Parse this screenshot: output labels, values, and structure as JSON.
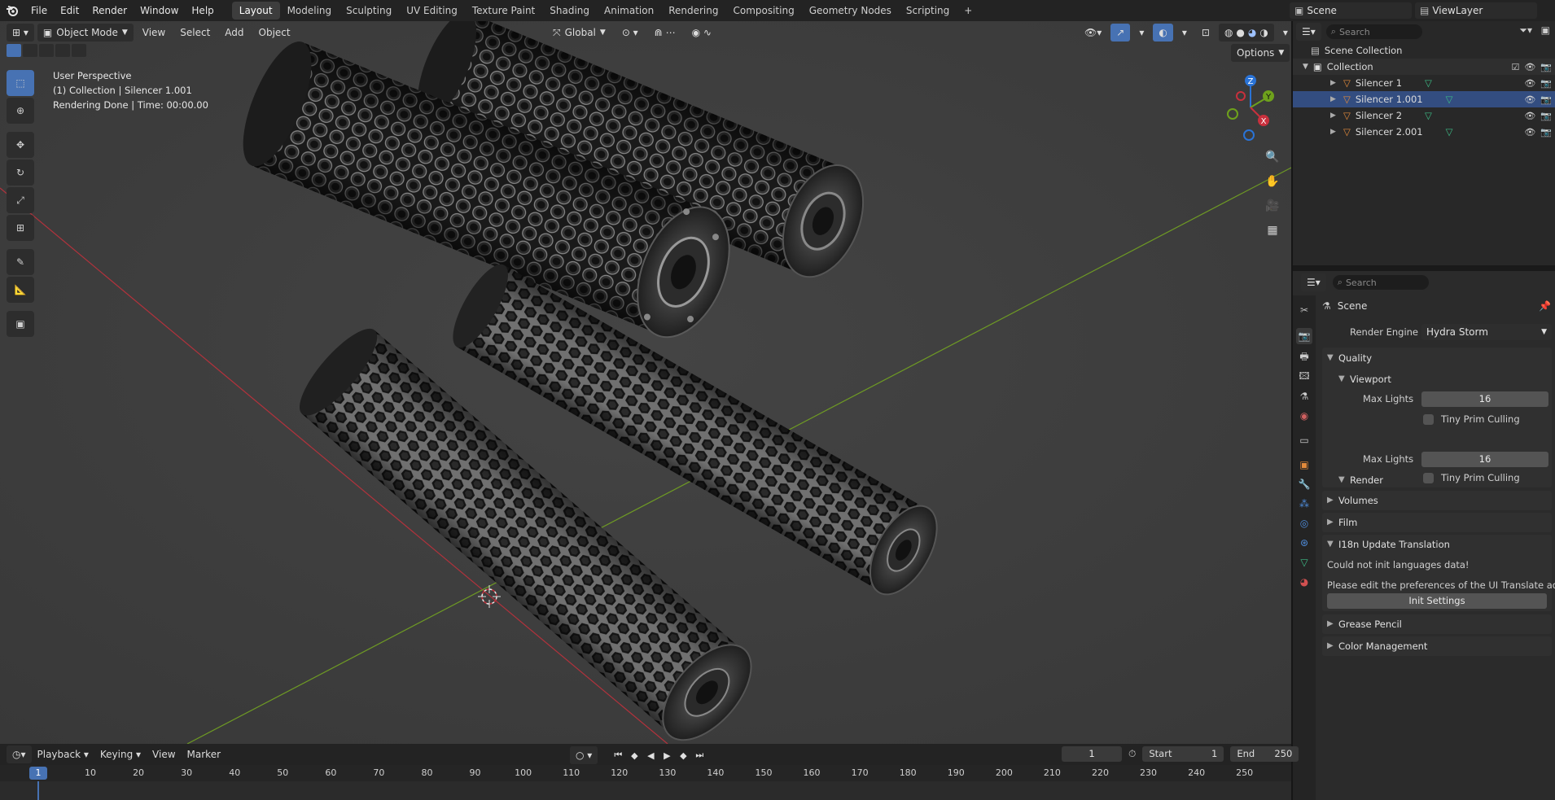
{
  "app": {
    "menus": [
      "File",
      "Edit",
      "Render",
      "Window",
      "Help"
    ],
    "workspaces": [
      "Layout",
      "Modeling",
      "Sculpting",
      "UV Editing",
      "Texture Paint",
      "Shading",
      "Animation",
      "Rendering",
      "Compositing",
      "Geometry Nodes",
      "Scripting"
    ],
    "active_workspace": "Layout",
    "add_workspace": "+",
    "scene": "Scene",
    "view_layer": "ViewLayer"
  },
  "viewport": {
    "mode": "Object Mode",
    "menus": [
      "View",
      "Select",
      "Add",
      "Object"
    ],
    "transform_orientation": "Global",
    "options_label": "Options",
    "overlay_lines": [
      "User Perspective",
      "(1) Collection | Silencer 1.001",
      "Rendering Done | Time: 00:00.00"
    ],
    "gizmo_labels": {
      "x": "X",
      "y": "Y",
      "z": "Z"
    },
    "colors": {
      "x_axis": "#c8303d",
      "y_axis": "#6ea11c",
      "z_axis": "#2a73d6",
      "active_tool": "#4772b3"
    }
  },
  "outliner": {
    "search_placeholder": "Search",
    "root": "Scene Collection",
    "collection": "Collection",
    "objects": [
      {
        "name": "Silencer 1",
        "selected": false
      },
      {
        "name": "Silencer 1.001",
        "selected": true
      },
      {
        "name": "Silencer 2",
        "selected": false
      },
      {
        "name": "Silencer 2.001",
        "selected": false
      }
    ]
  },
  "properties": {
    "search_placeholder": "Search",
    "context": "Scene",
    "render_engine_label": "Render Engine",
    "render_engine": "Hydra Storm",
    "quality_label": "Quality",
    "viewport_label": "Viewport",
    "render_label": "Render",
    "max_lights_label": "Max Lights",
    "viewport_max_lights": "16",
    "render_max_lights": "16",
    "tiny_prim_label": "Tiny Prim Culling",
    "volumes_label": "Volumes",
    "film_label": "Film",
    "i18n_label": "I18n Update Translation",
    "i18n_msg1": "Could not init languages data!",
    "i18n_msg2": "Please edit the preferences of the UI Translate ad...",
    "init_settings": "Init Settings",
    "grease_pencil_label": "Grease Pencil",
    "color_management_label": "Color Management"
  },
  "timeline": {
    "menus": [
      "Playback",
      "Keying",
      "View",
      "Marker"
    ],
    "current_frame": "1",
    "start_label": "Start",
    "start": "1",
    "end_label": "End",
    "end": "250",
    "ticks": [
      "10",
      "20",
      "30",
      "40",
      "50",
      "60",
      "70",
      "80",
      "90",
      "100",
      "110",
      "120",
      "130",
      "140",
      "150",
      "160",
      "170",
      "180",
      "190",
      "200",
      "210",
      "220",
      "230",
      "240",
      "250"
    ],
    "playhead_label": "1"
  }
}
